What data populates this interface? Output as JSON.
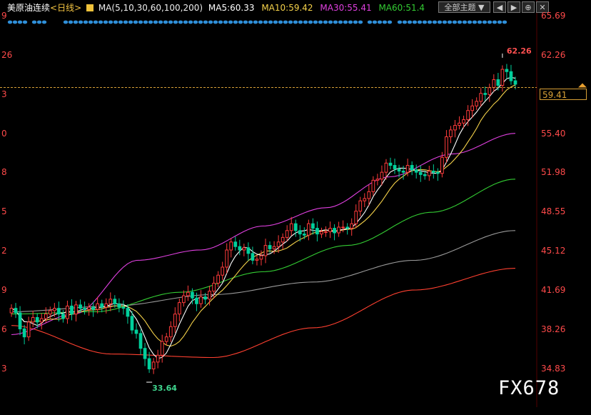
{
  "header": {
    "symbol": "美原油连续",
    "period": "<日线>",
    "ma_spec": "MA(5,10,30,60,100,200)",
    "ma5": "MA5:60.33",
    "ma10": "MA10:59.42",
    "ma30": "MA30:55.41",
    "ma60": "MA60:51.4"
  },
  "toolbar": {
    "theme_select": "全部主题",
    "buttons": [
      "◀",
      "▶",
      "⊕",
      "✕"
    ]
  },
  "colors": {
    "up": "#ff3b3b",
    "down": "#00d09c",
    "ma5": "#ffffff",
    "ma10": "#f5d24a",
    "ma30": "#e040e0",
    "ma60": "#33cc33",
    "ma100": "#9a9a9a",
    "ma200": "#ff4030",
    "axis_text": "#ff4a4a",
    "dots": "#2f8fd9"
  },
  "chart_data": {
    "type": "candlestick",
    "ylim": [
      33.0,
      66.3
    ],
    "y_ticks": [
      "65.69",
      "62.26",
      "55.40",
      "51.98",
      "48.55",
      "45.12",
      "41.69",
      "38.26",
      "34.83"
    ],
    "y_ticks_values": [
      65.69,
      62.26,
      55.4,
      51.98,
      48.55,
      45.12,
      41.69,
      38.26,
      34.83
    ],
    "left_ticks": [
      "9",
      "26",
      "3",
      "0",
      "8",
      "5",
      "2",
      "9",
      "6",
      "3"
    ],
    "left_ticks_values": [
      65.69,
      62.26,
      58.83,
      55.4,
      51.98,
      48.55,
      45.12,
      41.69,
      38.26,
      34.83
    ],
    "current_price": 59.41,
    "current_price_label": "59.41",
    "high_annotation": {
      "value": 62.26,
      "label": "62.26"
    },
    "low_annotation": {
      "value": 33.64,
      "label": "33.64"
    },
    "close_series": [
      40.1,
      39.7,
      38.3,
      37.6,
      38.9,
      39.3,
      38.9,
      39.2,
      39.6,
      39.9,
      40.1,
      39.6,
      39.2,
      40.3,
      39.6,
      40.4,
      40.1,
      40.0,
      40.2,
      40.0,
      40.5,
      40.2,
      40.5,
      40.9,
      40.5,
      40.2,
      40.1,
      39.4,
      38.2,
      37.9,
      36.6,
      35.7,
      34.8,
      35.4,
      36.0,
      37.2,
      37.6,
      38.5,
      39.6,
      40.6,
      41.2,
      41.5,
      41.0,
      40.5,
      41.1,
      40.9,
      41.6,
      42.3,
      43.0,
      43.7,
      45.2,
      45.9,
      45.5,
      45.2,
      45.4,
      44.9,
      44.3,
      44.4,
      44.7,
      45.6,
      45.3,
      45.5,
      45.9,
      46.3,
      46.9,
      47.5,
      46.9,
      46.6,
      46.5,
      47.5,
      47.1,
      46.6,
      46.8,
      46.8,
      47.1,
      46.7,
      47.2,
      47.2,
      47.1,
      47.5,
      48.6,
      49.5,
      49.7,
      50.3,
      51.3,
      51.4,
      52.0,
      52.8,
      52.6,
      52.3,
      52.1,
      52.0,
      52.6,
      52.2,
      52.0,
      51.8,
      51.7,
      52.1,
      52.0,
      51.9,
      53.3,
      55.1,
      55.7,
      56.1,
      56.3,
      56.6,
      57.4,
      57.8,
      58.2,
      58.9,
      58.8,
      59.4,
      60.1,
      59.6,
      61.0,
      60.8,
      60.0,
      59.7
    ],
    "ma30": [
      37.8,
      39.6,
      44.3,
      45.2,
      47.3,
      48.9,
      51.6,
      53.6,
      55.4
    ],
    "ma60": [
      39.6,
      39.8,
      41.5,
      43.3,
      45.6,
      48.5,
      51.4
    ],
    "ma100": [
      39.8,
      40.3,
      41.3,
      42.4,
      44.3,
      46.9
    ],
    "ma200": [
      38.6,
      36.1,
      35.8,
      38.4,
      41.7,
      43.6
    ]
  }
}
